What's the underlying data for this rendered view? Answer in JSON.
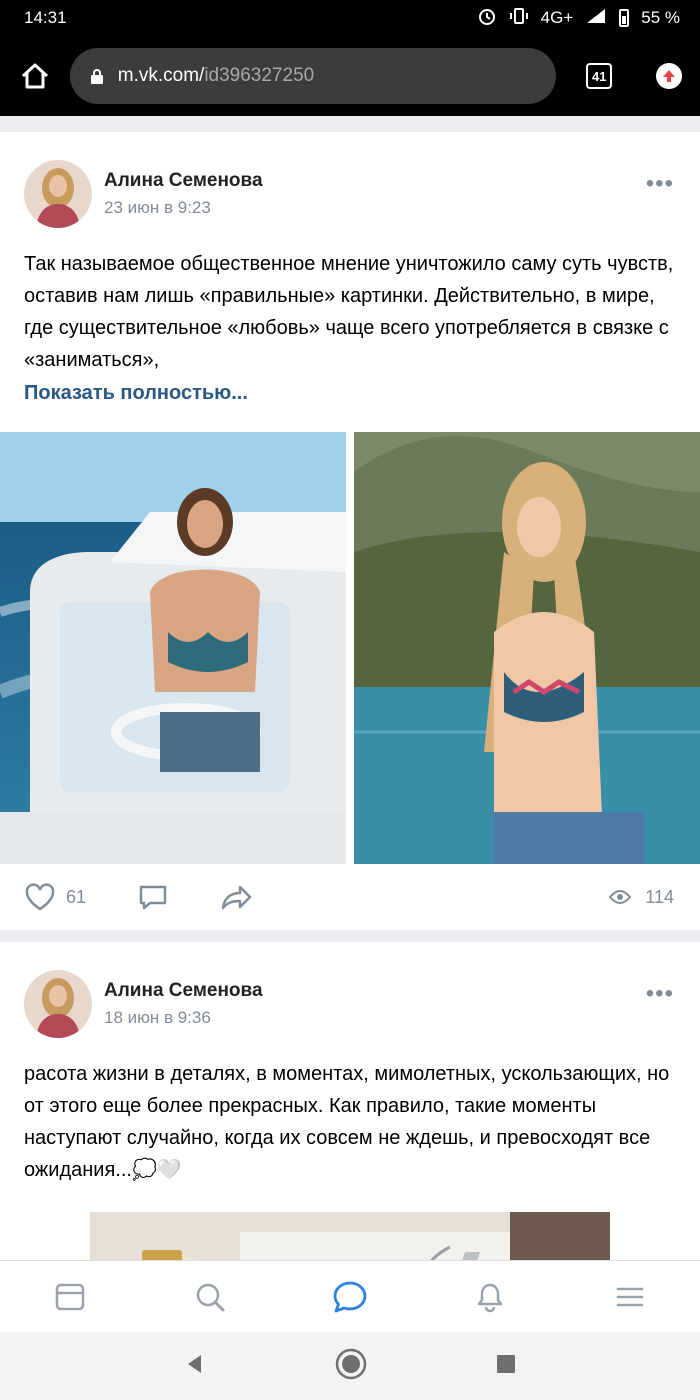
{
  "status_bar": {
    "time": "14:31",
    "network": "4G+",
    "battery": "55 %"
  },
  "browser": {
    "url_host": "m.vk.com/",
    "url_path": "id396327250",
    "tab_count": "41"
  },
  "posts": [
    {
      "author": "Алина Семенова",
      "date": "23 июн в 9:23",
      "text": "Так называемое общественное мнение уничтожило саму суть чувств, оставив нам лишь «правильные» картинки. Действительно, в мире, где существительное «любовь» чаще всего употребляется в связке с «заниматься»,",
      "show_more": "Показать полностью...",
      "likes": "61",
      "views": "114"
    },
    {
      "author": "Алина Семенова",
      "date": "18 июн в 9:36",
      "text": "расота жизни в деталях, в моментах, мимолетных, ускользающих, но от этого еще более прекрасных. Как правило, такие моменты наступают случайно, когда их совсем не ждешь, и превосходят все ожидания...💭🤍"
    }
  ],
  "colors": {
    "link": "#2a5885",
    "secondary": "#818c99",
    "accent": "#2d81e0"
  },
  "icons": {
    "bottom_nav": [
      "news-icon",
      "search-icon",
      "messages-icon",
      "notifications-icon",
      "menu-icon"
    ],
    "system_nav": [
      "back-icon",
      "home-icon",
      "recents-icon"
    ]
  }
}
